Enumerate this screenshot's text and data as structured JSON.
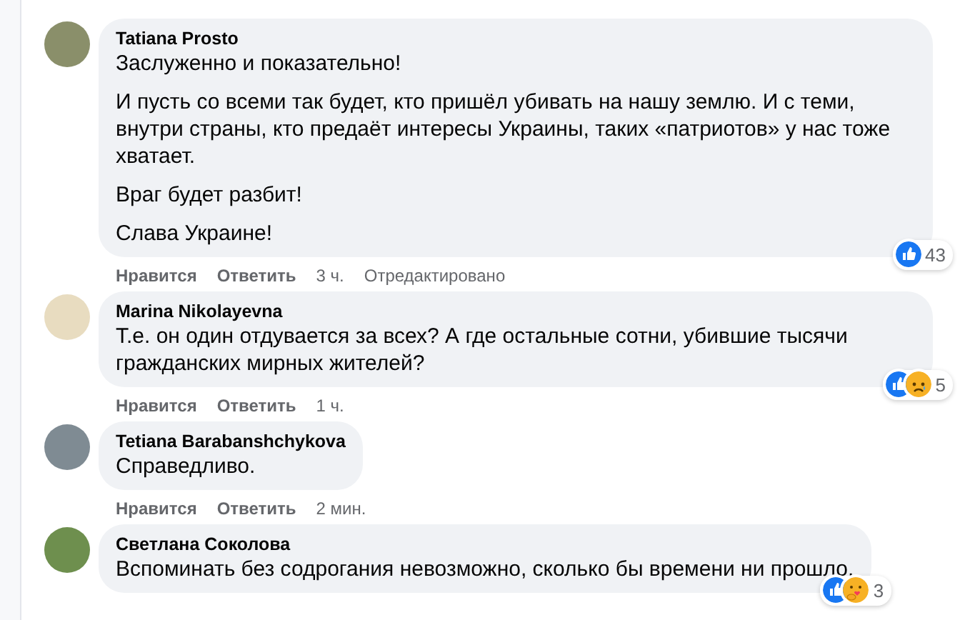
{
  "comments": [
    {
      "author": "Tatiana Prosto",
      "paragraphs": [
        "Заслуженно и показательно!",
        "И пусть со всеми так будет, кто пришёл убивать на нашу землю. И с теми, внутри страны, кто предаёт интересы Украины, таких «патриотов» у нас тоже хватает.",
        "Враг будет разбит!",
        "Слава Украине!"
      ],
      "actions": [
        "Нравится",
        "Ответить"
      ],
      "time": "3 ч.",
      "edited": "Отредактировано",
      "reactions": {
        "icons": [
          {
            "kind": "like"
          }
        ],
        "count": "43"
      }
    },
    {
      "author": "Marina Nikolayevna",
      "paragraphs": [
        "Т.е. он один отдувается за всех? А где остальные сотни, убившие тысячи гражданских мирных жителей?"
      ],
      "actions": [
        "Нравится",
        "Ответить"
      ],
      "time": "1 ч.",
      "reactions": {
        "icons": [
          {
            "kind": "like"
          },
          {
            "kind": "sad"
          }
        ],
        "count": "5"
      }
    },
    {
      "author": "Tetiana Barabanshchykova",
      "paragraphs": [
        "Справедливо."
      ],
      "actions": [
        "Нравится",
        "Ответить"
      ],
      "time": "2 мин."
    },
    {
      "author": "Светлана Соколова",
      "paragraphs": [
        "Вспоминать без содрогания невозможно, сколько бы времени ни прошло."
      ],
      "reactions": {
        "icons": [
          {
            "kind": "like"
          },
          {
            "kind": "care"
          }
        ],
        "count": "3"
      }
    }
  ]
}
